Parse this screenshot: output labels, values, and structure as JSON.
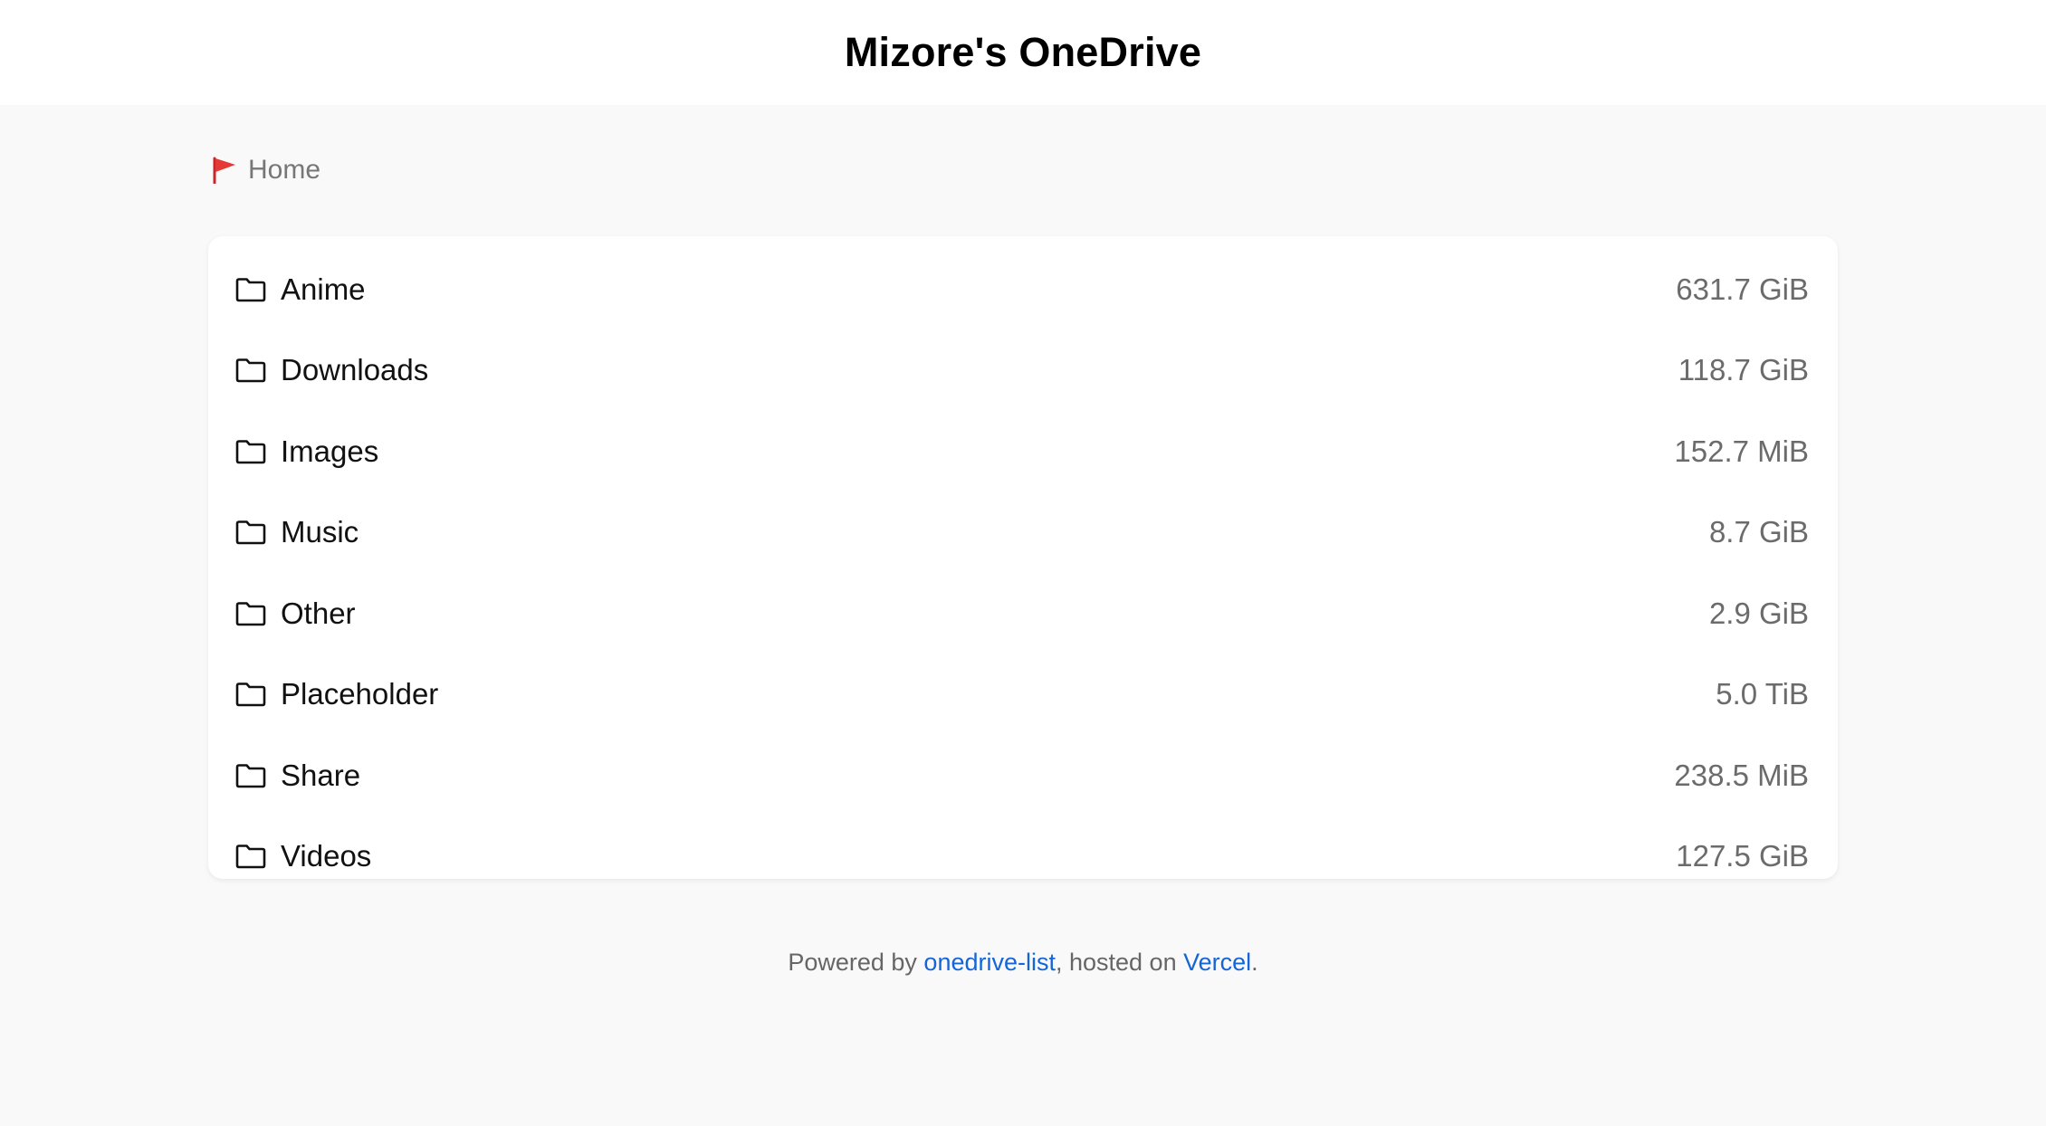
{
  "header": {
    "title": "Mizore's OneDrive"
  },
  "breadcrumb": {
    "icon": "flag-icon",
    "icon_color": "#e53935",
    "home_label": "Home"
  },
  "folders": [
    {
      "name": "Anime",
      "size": "631.7 GiB",
      "icon": "folder-icon"
    },
    {
      "name": "Downloads",
      "size": "118.7 GiB",
      "icon": "folder-icon"
    },
    {
      "name": "Images",
      "size": "152.7 MiB",
      "icon": "folder-icon"
    },
    {
      "name": "Music",
      "size": "8.7 GiB",
      "icon": "folder-icon"
    },
    {
      "name": "Other",
      "size": "2.9 GiB",
      "icon": "folder-icon"
    },
    {
      "name": "Placeholder",
      "size": "5.0 TiB",
      "icon": "folder-icon"
    },
    {
      "name": "Share",
      "size": "238.5 MiB",
      "icon": "folder-icon"
    },
    {
      "name": "Videos",
      "size": "127.5 GiB",
      "icon": "folder-icon"
    }
  ],
  "footer": {
    "prefix": "Powered by ",
    "link1_label": "onedrive-list",
    "middle": ", hosted on ",
    "link2_label": "Vercel",
    "suffix": ".",
    "link_color": "#1565d8"
  }
}
